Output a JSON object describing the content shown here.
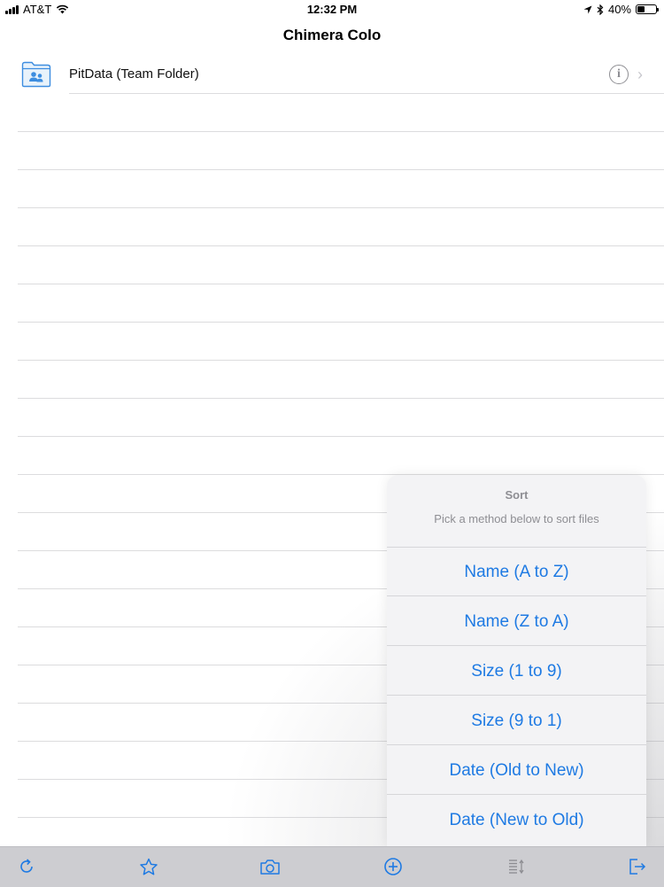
{
  "status_bar": {
    "carrier": "AT&T",
    "time": "12:32 PM",
    "battery": "40%",
    "battery_level": 0.4
  },
  "nav": {
    "title": "Chimera Colo"
  },
  "list": {
    "items": [
      {
        "name": "PitData (Team Folder)",
        "icon": "team-folder-icon"
      }
    ]
  },
  "sort_popover": {
    "title": "Sort",
    "message": "Pick a method below to sort files",
    "options": [
      "Name (A to Z)",
      "Name (Z to A)",
      "Size (1 to 9)",
      "Size (9 to 1)",
      "Date (Old to New)",
      "Date (New to Old)"
    ]
  },
  "toolbar": {
    "buttons": [
      "refresh-icon",
      "star-icon",
      "camera-icon",
      "add-icon",
      "sort-icon",
      "logout-icon"
    ]
  },
  "colors": {
    "accent": "#1e7ae3",
    "toolbar_bg": "#cdcdd1",
    "popover_bg": "#f3f3f5"
  }
}
